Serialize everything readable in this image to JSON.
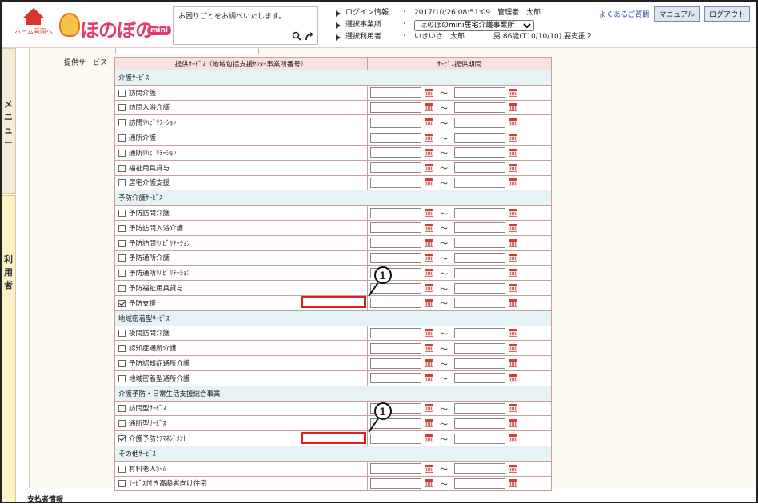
{
  "header": {
    "home_label": "ホーム画面へ",
    "logo_text": "ほのぼの",
    "logo_badge": "mini",
    "help_text": "お困りごとをお調べいたします。",
    "info": [
      {
        "key": "ログイン情報",
        "sep": ":",
        "value": "2017/10/26 08:51:09　管理者　太郎"
      },
      {
        "key": "選択事業所",
        "sep": ":",
        "value": "ほのぼのmini居宅介護事業所"
      },
      {
        "key": "選択利用者",
        "sep": ":",
        "value": "いきいき　太郎　　　　男 86歳(T10/10/10) 要支援２"
      }
    ],
    "faq_label": "よくあるご質問",
    "manual_label": "マニュアル",
    "logout_label": "ログアウト"
  },
  "side_tabs": {
    "menu": "メニュー",
    "user": "利用者"
  },
  "section": {
    "label": "提供サービス",
    "col_service": "提供ｻｰﾋﾞｽ（地域包括支援ｾﾝﾀｰ事業所番号）",
    "col_period": "ｻｰﾋﾞｽ提供期間",
    "tilde": "～"
  },
  "rows": [
    {
      "type": "cat",
      "label": "介護ｻｰﾋﾞｽ"
    },
    {
      "type": "svc",
      "label": "訪問介護",
      "checked": false
    },
    {
      "type": "svc",
      "label": "訪問入浴介護",
      "checked": false
    },
    {
      "type": "svc",
      "label": "訪問ﾘﾊﾋﾞﾘﾃｰｼｮﾝ",
      "checked": false
    },
    {
      "type": "svc",
      "label": "通所介護",
      "checked": false
    },
    {
      "type": "svc",
      "label": "通所ﾘﾊﾋﾞﾘﾃｰｼｮﾝ",
      "checked": false
    },
    {
      "type": "svc",
      "label": "福祉用具貸与",
      "checked": false
    },
    {
      "type": "svc",
      "label": "居宅介護支援",
      "checked": false
    },
    {
      "type": "cat",
      "label": "予防介護ｻｰﾋﾞｽ"
    },
    {
      "type": "svc",
      "label": "予防訪問介護",
      "checked": false
    },
    {
      "type": "svc",
      "label": "予防訪問入浴介護",
      "checked": false
    },
    {
      "type": "svc",
      "label": "予防訪問ﾘﾊﾋﾞﾘﾃｰｼｮﾝ",
      "checked": false
    },
    {
      "type": "svc",
      "label": "予防通所介護",
      "checked": false
    },
    {
      "type": "svc",
      "label": "予防通所ﾘﾊﾋﾞﾘﾃｰｼｮﾝ",
      "checked": false
    },
    {
      "type": "svc",
      "label": "予防福祉用具貸与",
      "checked": false
    },
    {
      "type": "svc",
      "label": "予防支援",
      "checked": true,
      "callout": "1"
    },
    {
      "type": "cat",
      "label": "地域密着型ｻｰﾋﾞｽ"
    },
    {
      "type": "svc",
      "label": "夜間訪問介護",
      "checked": false
    },
    {
      "type": "svc",
      "label": "認知症通所介護",
      "checked": false
    },
    {
      "type": "svc",
      "label": "予防認知症通所介護",
      "checked": false
    },
    {
      "type": "svc",
      "label": "地域密着型通所介護",
      "checked": false
    },
    {
      "type": "cat",
      "label": "介護予防・日常生活支援総合事業"
    },
    {
      "type": "svc",
      "label": "訪問型ｻｰﾋﾞｽ",
      "checked": false
    },
    {
      "type": "svc",
      "label": "通所型ｻｰﾋﾞｽ",
      "checked": false
    },
    {
      "type": "svc",
      "label": "介護予防ｹｱﾏﾈｼﾞﾒﾝﾄ",
      "checked": true,
      "callout": "1"
    },
    {
      "type": "cat",
      "label": "その他ｻｰﾋﾞｽ"
    },
    {
      "type": "svc",
      "label": "有料老人ﾎｰﾑ",
      "checked": false
    },
    {
      "type": "svc",
      "label": "ｻｰﾋﾞｽ付き高齢者向け住宅",
      "checked": false
    }
  ],
  "footer": {
    "payer_label": "支払者情報"
  },
  "colors": {
    "accent_red": "#e21d1d",
    "header_pink": "#fbe0e0",
    "category_blue": "#e5f3f6",
    "brand_pink": "#e43b6a"
  }
}
